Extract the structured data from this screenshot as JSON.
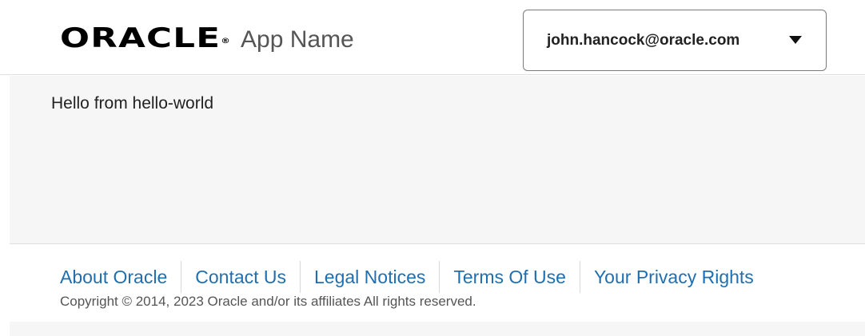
{
  "header": {
    "logo_text": "ORACLE",
    "app_name": "App Name",
    "user_menu": {
      "email": "john.hancock@oracle.com",
      "icon": "caret-down-icon"
    }
  },
  "main": {
    "message": "Hello from hello-world"
  },
  "footer": {
    "links": [
      "About Oracle",
      "Contact Us",
      "Legal Notices",
      "Terms Of Use",
      "Your Privacy Rights"
    ],
    "copyright": "Copyright © 2014, 2023 Oracle and/or its affiliates All rights reserved."
  },
  "colors": {
    "link": "#1f6fb0",
    "content_bg": "#f6f6f6"
  }
}
